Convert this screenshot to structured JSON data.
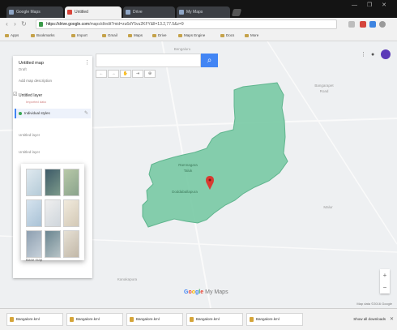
{
  "browser": {
    "tabs": [
      {
        "label": "Google Maps",
        "active": false
      },
      {
        "label": "Untitled",
        "active": true
      },
      {
        "label": "Drive",
        "active": false
      },
      {
        "label": "My Maps",
        "active": false
      }
    ],
    "window_controls": "— ❐ ✕",
    "url_host": "https://drive.google.com",
    "url_rest": "/maps/d/edit?mid=zu6dY5vu2KFY&ll=13.2,77.5&z=9",
    "bookmarks": [
      "Apps",
      "Bookmarks",
      "Import",
      "Gmail",
      "Maps",
      "Drive",
      "Maps Engine",
      "Docs",
      "More"
    ]
  },
  "map": {
    "search_placeholder": "",
    "nav_buttons": [
      "←",
      "→",
      "✋",
      "⇥",
      "⊕"
    ],
    "place_labels": {
      "north": "Bengaluru",
      "east_town": "Bangarapet",
      "east_town_sub": "Road",
      "region_label": "Ramnagara",
      "region_sub": "Taluk",
      "marker_label": "Doddaballapura",
      "southeast": "Malur",
      "southwest": "Kanakapura"
    },
    "google_logo": "Google My Maps",
    "footer": "Map data ©2016 Google",
    "zoom_in": "+",
    "zoom_out": "−",
    "region_color": "#78c9a4",
    "marker_color": "#d93b32"
  },
  "panel": {
    "title": "Untitled map",
    "subtitle": "Draft",
    "description": "Add map description",
    "layer_header": "Untitled layer",
    "layer_meta": "Imported data",
    "layer_item": "Individual styles",
    "sub_a": "Untitled layer",
    "sub_b": "Untitled layer",
    "basemap_label": "Base map"
  },
  "downloads": {
    "items": [
      "Bangalore.kml",
      "Bangalore.kml",
      "Bangalore.kml",
      "Bangalore.kml",
      "Bangalore.kml"
    ],
    "show_all": "Show all downloads",
    "close": "✕"
  }
}
